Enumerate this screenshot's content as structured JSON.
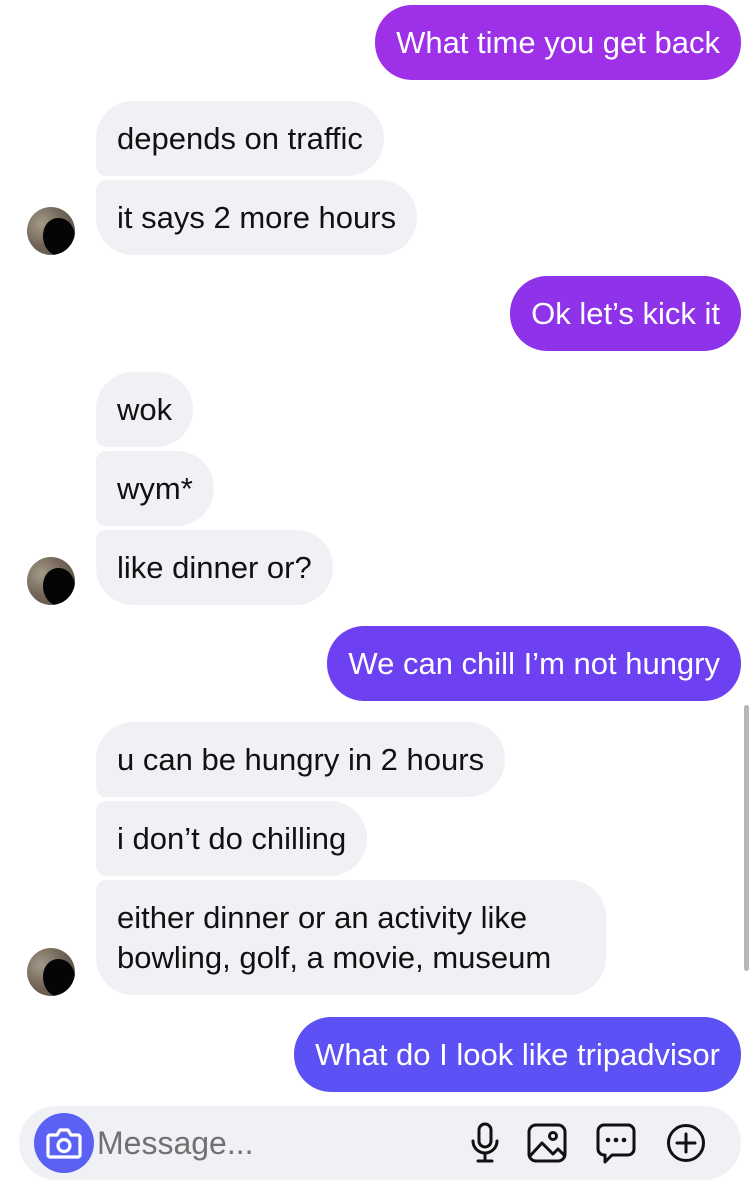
{
  "colors": {
    "incoming_bubble": "#eff1f4",
    "outgoing_bubble_top": "#9b31e6",
    "outgoing_bubble_bottom": "#5d51f4",
    "camera_button": "#5b61f4"
  },
  "messages": [
    {
      "sender": "me",
      "text": "What time you get back"
    },
    {
      "sender": "them",
      "text": "depends on traffic"
    },
    {
      "sender": "them",
      "text": "it says 2 more hours"
    },
    {
      "sender": "me",
      "text": "Ok let’s kick it"
    },
    {
      "sender": "them",
      "text": "wok"
    },
    {
      "sender": "them",
      "text": "wym*"
    },
    {
      "sender": "them",
      "text": "like dinner or?"
    },
    {
      "sender": "me",
      "text": "We can chill I’m not hungry"
    },
    {
      "sender": "them",
      "text": "u can be hungry in 2 hours"
    },
    {
      "sender": "them",
      "text": "i don’t do chilling"
    },
    {
      "sender": "them",
      "text": "either dinner or an activity like bowling, golf, a movie, museum"
    },
    {
      "sender": "me",
      "text": "What do I look like tripadvisor"
    }
  ],
  "composer": {
    "placeholder": "Message...",
    "icons": [
      "camera-icon",
      "microphone-icon",
      "image-icon",
      "sticker-icon",
      "plus-icon"
    ]
  }
}
